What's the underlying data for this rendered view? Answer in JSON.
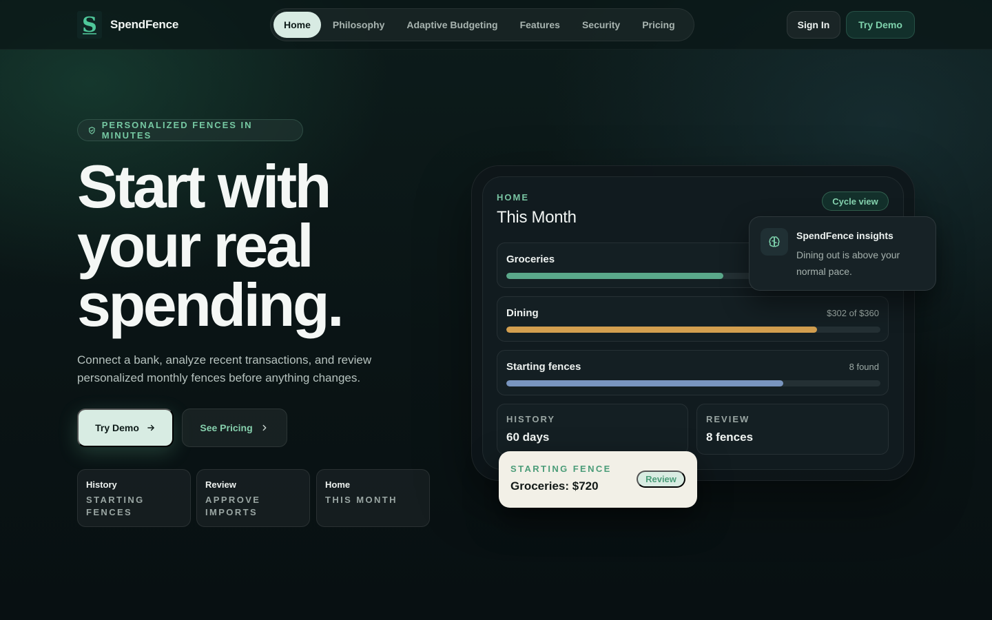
{
  "brand": {
    "name": "SpendFence",
    "logo_glyph": "S"
  },
  "nav": {
    "items": [
      {
        "label": "Home",
        "active": true
      },
      {
        "label": "Philosophy"
      },
      {
        "label": "Adaptive Budgeting"
      },
      {
        "label": "Features"
      },
      {
        "label": "Security"
      },
      {
        "label": "Pricing"
      }
    ],
    "sign_in": "Sign In",
    "try_demo": "Try Demo"
  },
  "hero": {
    "eyebrow": "PERSONALIZED FENCES IN MINUTES",
    "headline": [
      "Start with",
      "your real",
      "spending."
    ],
    "lede": "Connect a bank, analyze recent transactions, and review personalized monthly fences before anything changes.",
    "cta_primary": "Try Demo",
    "cta_secondary": "See Pricing",
    "chips": [
      {
        "label": "History",
        "value": "STARTING FENCES"
      },
      {
        "label": "Review",
        "value": "APPROVE IMPORTS"
      },
      {
        "label": "Home",
        "value": "THIS MONTH"
      }
    ]
  },
  "dashboard": {
    "label": "HOME",
    "title": "This Month",
    "cycle_button": "Cycle view",
    "bars": [
      {
        "name": "Groceries",
        "meta": "",
        "progress": 0.58,
        "color": "#5aa88a"
      },
      {
        "name": "Dining",
        "meta": "$302 of $360",
        "progress": 0.83,
        "color": "#d39f4f"
      },
      {
        "name": "Starting fences",
        "meta": "8 found",
        "progress": 0.74,
        "color": "#7995bf"
      }
    ],
    "stats": [
      {
        "label": "HISTORY",
        "value": "60 days"
      },
      {
        "label": "REVIEW",
        "value": "8 fences"
      }
    ],
    "insight": {
      "title": "SpendFence insights",
      "text": "Dining out is above your normal pace.",
      "icon": "brain-icon"
    },
    "fence_card": {
      "label": "STARTING FENCE",
      "value": "Groceries: $720",
      "action": "Review"
    }
  },
  "colors": {
    "accent": "#7fd3ad",
    "background": "#0a1415"
  }
}
